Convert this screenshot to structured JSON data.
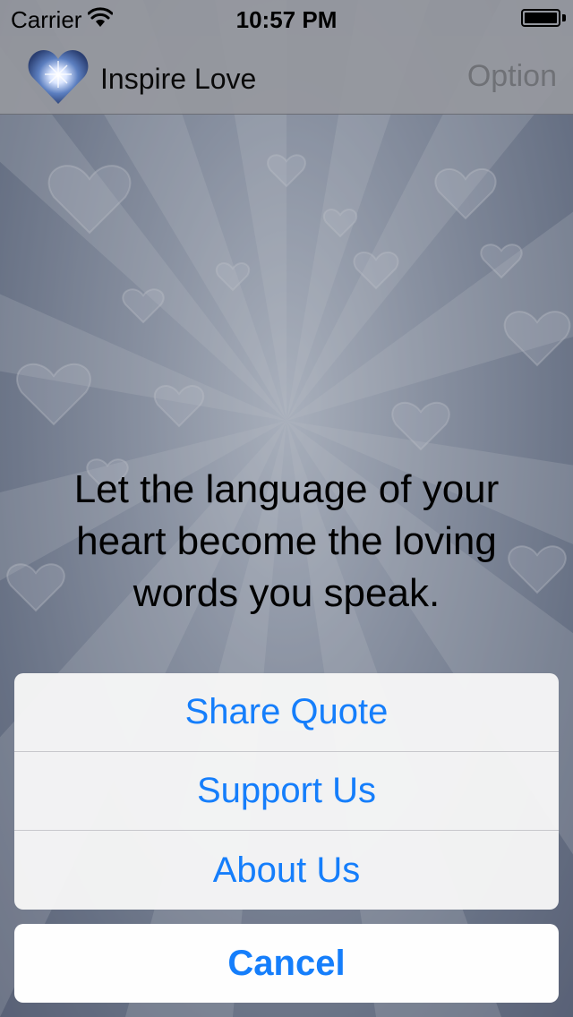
{
  "status_bar": {
    "carrier": "Carrier",
    "time": "10:57 PM"
  },
  "nav": {
    "title": "Inspire Love",
    "option_label": "Option"
  },
  "quote": {
    "text": "Let the language of your heart become the loving words you speak."
  },
  "action_sheet": {
    "items": [
      {
        "label": "Share Quote"
      },
      {
        "label": "Support Us"
      },
      {
        "label": "About Us"
      }
    ],
    "cancel_label": "Cancel"
  },
  "colors": {
    "accent": "#157efb",
    "background": "#8a93a6"
  },
  "icons": {
    "logo": "heart-logo-icon",
    "wifi": "wifi-icon",
    "battery": "battery-icon"
  }
}
